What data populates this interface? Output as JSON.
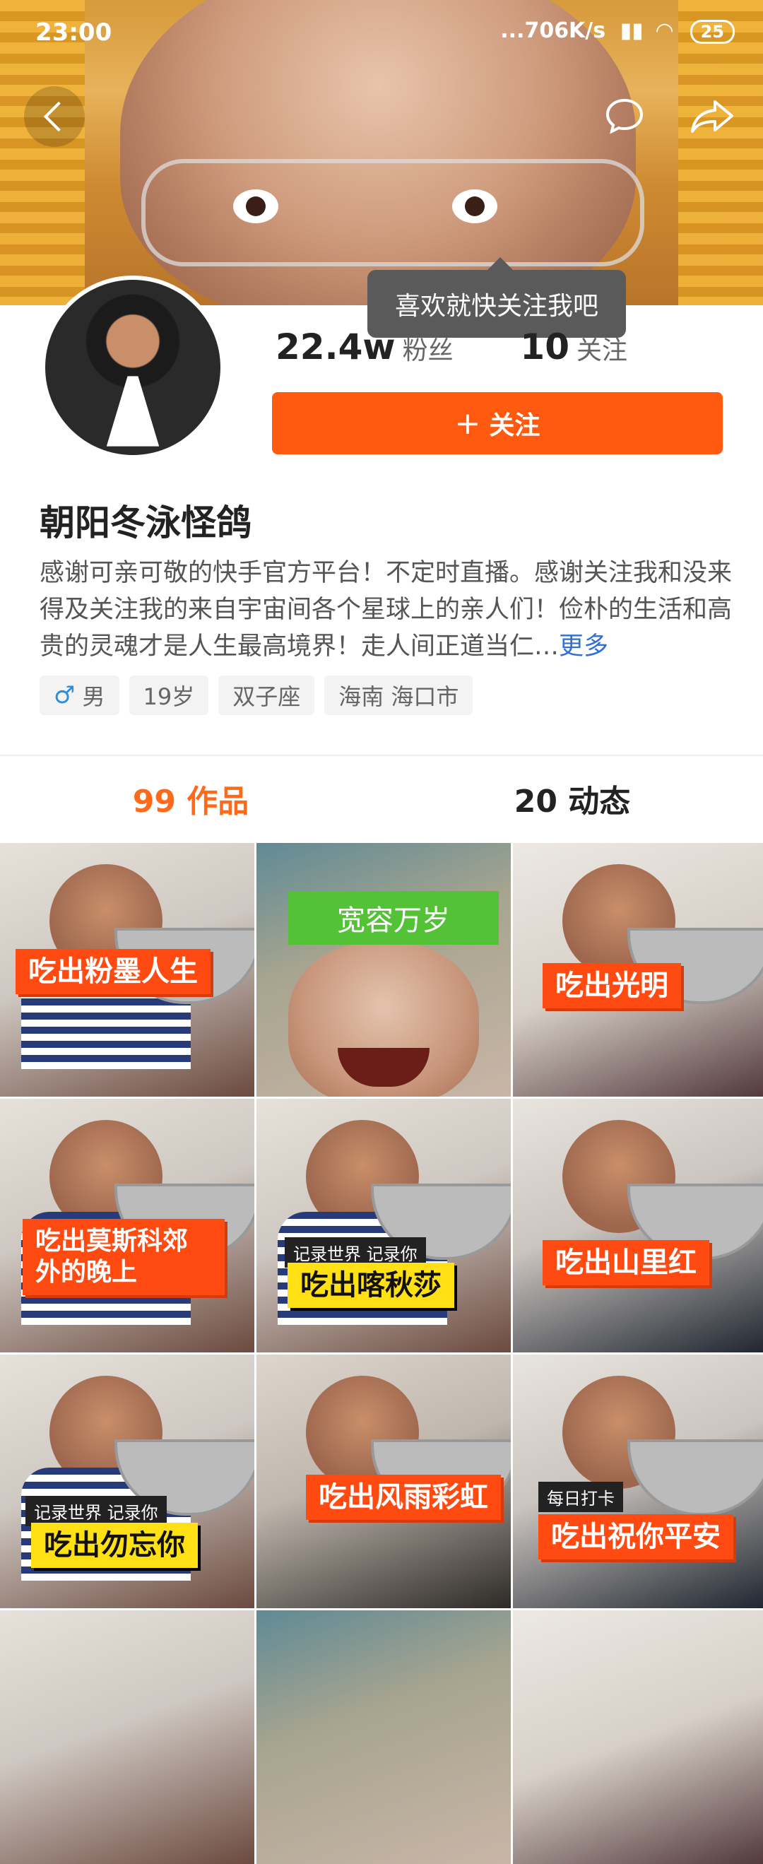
{
  "status": {
    "time": "23:00",
    "network": "...706K/s",
    "battery": "25"
  },
  "header": {
    "tooltip": "喜欢就快关注我吧"
  },
  "profile": {
    "fans_count": "22.4w",
    "fans_label": "粉丝",
    "following_count": "10",
    "following_label": "关注",
    "follow_button": "关注",
    "name": "朝阳冬泳怪鸽",
    "bio": "感谢可亲可敬的快手官方平台！不定时直播。感谢关注我和没来得及关注我的来自宇宙间各个星球上的亲人们！俭朴的生活和高贵的灵魂才是人生最高境界！走人间正道当仁…",
    "bio_more": "更多",
    "tags": {
      "gender": "男",
      "age": "19岁",
      "zodiac": "双子座",
      "location": "海南 海口市"
    }
  },
  "tabs": {
    "works": "99 作品",
    "moments": "20 动态"
  },
  "grid": [
    {
      "caption": "吃出粉墨人生"
    },
    {
      "caption": "宽容万岁"
    },
    {
      "caption": "吃出光明"
    },
    {
      "caption": "吃出莫斯科郊外的晚上"
    },
    {
      "sub": "记录世界 记录你",
      "caption": "吃出喀秋莎"
    },
    {
      "caption": "吃出山里红"
    },
    {
      "sub": "记录世界 记录你",
      "caption": "吃出勿忘你"
    },
    {
      "caption": "吃出风雨彩虹"
    },
    {
      "sub": "每日打卡",
      "caption": "吃出祝你平安"
    }
  ],
  "icons": {
    "back": "back-arrow-icon",
    "message": "message-bubble-icon",
    "share": "share-arrow-icon",
    "male": "male-icon",
    "plus": "plus-icon"
  },
  "colors": {
    "accent": "#ff5a10",
    "tab_active": "#ff6a1a",
    "link": "#2f6fd6"
  }
}
